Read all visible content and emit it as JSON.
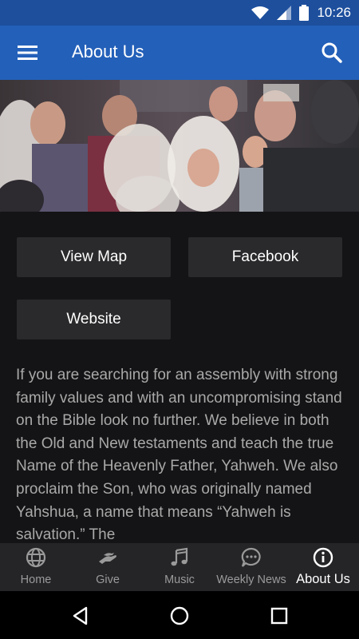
{
  "status_bar": {
    "time": "10:26"
  },
  "app_bar": {
    "title": "About Us"
  },
  "buttons": {
    "view_map": "View Map",
    "facebook": "Facebook",
    "website": "Website"
  },
  "about": {
    "text": "If you are searching for an assembly with strong family values and with an uncompromising stand on the Bible look no further. We believe in both the Old and New testaments and teach the true Name of the Heavenly Father, Yahweh. We also proclaim the Son, who was originally named Yahshua, a name that means “Yahweh is salvation.” The"
  },
  "bottom_nav": {
    "home": "Home",
    "give": "Give",
    "music": "Music",
    "weekly_news": "Weekly News",
    "about_us": "About Us"
  },
  "colors": {
    "status_bar": "#1d4f9d",
    "app_bar": "#2360b9",
    "background": "#141416",
    "button": "#2a2a2c",
    "nav": "#252528"
  }
}
